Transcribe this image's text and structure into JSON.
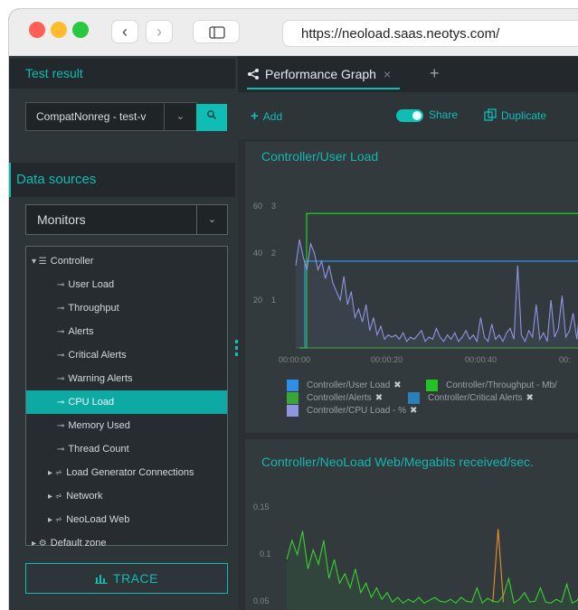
{
  "browser": {
    "url": "https://neoload.saas.neotys.com/",
    "back_glyph": "‹",
    "forward_glyph": "›"
  },
  "sidebar": {
    "test_result_title": "Test result",
    "test_select_value": "CompatNonreg - test-v",
    "data_sources_title": "Data sources",
    "monitors_select_value": "Monitors",
    "tree": [
      {
        "label": "Controller",
        "level": 0,
        "kind": "group-open",
        "glyph": "▾ ☰"
      },
      {
        "label": "User Load",
        "level": 1,
        "kind": "counter",
        "glyph": "⊸"
      },
      {
        "label": "Throughput",
        "level": 1,
        "kind": "counter",
        "glyph": "⊸"
      },
      {
        "label": "Alerts",
        "level": 1,
        "kind": "counter",
        "glyph": "⊸"
      },
      {
        "label": "Critical Alerts",
        "level": 1,
        "kind": "counter",
        "glyph": "⊸"
      },
      {
        "label": "Warning Alerts",
        "level": 1,
        "kind": "counter",
        "glyph": "⊸"
      },
      {
        "label": "CPU Load",
        "level": 1,
        "kind": "counter",
        "selected": true,
        "glyph": "⊸"
      },
      {
        "label": "Memory Used",
        "level": 1,
        "kind": "counter",
        "glyph": "⊸"
      },
      {
        "label": "Thread Count",
        "level": 1,
        "kind": "counter",
        "glyph": "⊸"
      },
      {
        "label": "Load Generator Connections",
        "level": 1,
        "kind": "group-closed",
        "glyph": "▸ ⩫"
      },
      {
        "label": "Network",
        "level": 1,
        "kind": "group-closed",
        "glyph": "▸ ⩫"
      },
      {
        "label": "NeoLoad Web",
        "level": 1,
        "kind": "group-closed",
        "glyph": "▸ ⩫"
      },
      {
        "label": "Default zone",
        "level": 0,
        "kind": "group-closed",
        "glyph": "▸ ⚙"
      }
    ],
    "trace_label": "TRACE"
  },
  "main": {
    "tab_label": "Performance Graph",
    "tab_close": "×",
    "tab_add": "+",
    "toolbar": {
      "add_label": "Add",
      "share_label": "Share",
      "duplicate_label": "Duplicate"
    }
  },
  "chart_data": [
    {
      "type": "line",
      "title": "Controller/User Load",
      "left_axis_ticks": [
        "60",
        "40",
        "20"
      ],
      "right_axis_ticks": [
        "3",
        "2",
        "1"
      ],
      "x_ticks": [
        "00:00:00",
        "00:00:20",
        "00:00:40",
        "00:"
      ],
      "series": [
        {
          "name": "Controller/User Load",
          "color": "#2f8fe8",
          "values": [
            2.0,
            2.0,
            2.0
          ]
        },
        {
          "name": "Controller/Throughput - Mb/",
          "color": "#22c522",
          "values": [
            0,
            62,
            62
          ]
        },
        {
          "name": "Controller/Alerts",
          "color": "#3aa63a",
          "values": [
            0,
            0,
            0
          ]
        },
        {
          "name": "Controller/Critical Alerts",
          "color": "#2a7fb8",
          "values": [
            0,
            0,
            0
          ]
        },
        {
          "name": "Controller/CPU Load - %",
          "color": "#8f95e0",
          "values": [
            38,
            50,
            42,
            36,
            48,
            44,
            36,
            40,
            32,
            38,
            30,
            26,
            22,
            33,
            20,
            26,
            14,
            18,
            12,
            20,
            8,
            14,
            6,
            10,
            4,
            6,
            5,
            6,
            4,
            7,
            3,
            5,
            4,
            6,
            8,
            3,
            5,
            4,
            9,
            5,
            3,
            6,
            4,
            7,
            3,
            5,
            8,
            4,
            6,
            3,
            14,
            5,
            3,
            11,
            4,
            6,
            3,
            7,
            9,
            4,
            38,
            6,
            3,
            8,
            5,
            20,
            4,
            7,
            3,
            22,
            5,
            9,
            24,
            5,
            8,
            16,
            4,
            21,
            6,
            5
          ]
        }
      ],
      "legend": [
        {
          "label": "Controller/User Load",
          "color": "#2f8fe8"
        },
        {
          "label": "Controller/Throughput - Mb/",
          "color": "#22c522"
        },
        {
          "label": "Controller/Alerts",
          "color": "#3aa63a"
        },
        {
          "label": "Controller/Critical Alerts",
          "color": "#2a7fb8"
        },
        {
          "label": "Controller/CPU Load - %",
          "color": "#8f95e0"
        }
      ],
      "legend_remove_glyph": "✖"
    },
    {
      "type": "line",
      "title": "Controller/NeoLoad Web/Megabits received/sec.",
      "y_ticks": [
        "0.15",
        "0.1",
        "0.05"
      ],
      "series": [
        {
          "name": "",
          "color": "#38d12e",
          "values": [
            0.09,
            0.11,
            0.095,
            0.12,
            0.08,
            0.1,
            0.085,
            0.11,
            0.07,
            0.09,
            0.065,
            0.075,
            0.06,
            0.08,
            0.055,
            0.065,
            0.05,
            0.06,
            0.048,
            0.055,
            0.045,
            0.05,
            0.044,
            0.048,
            0.045,
            0.05,
            0.044,
            0.047,
            0.05,
            0.046,
            0.045,
            0.048,
            0.044,
            0.05,
            0.046,
            0.045,
            0.06,
            0.044,
            0.049,
            0.046,
            0.045,
            0.052,
            0.07,
            0.044,
            0.048,
            0.055,
            0.045,
            0.046,
            0.06,
            0.045,
            0.044,
            0.048,
            0.045,
            0.064,
            0.044,
            0.047,
            0.06,
            0.045
          ]
        },
        {
          "name": "",
          "color": "#e8902a",
          "values": [
            null,
            null,
            null,
            null,
            null,
            null,
            null,
            null,
            null,
            null,
            null,
            null,
            null,
            null,
            null,
            null,
            null,
            null,
            null,
            null,
            null,
            null,
            null,
            null,
            null,
            null,
            null,
            null,
            null,
            null,
            null,
            null,
            null,
            null,
            null,
            null,
            null,
            null,
            null,
            0.045,
            0.122,
            0.045,
            null,
            null,
            null,
            null,
            null,
            null,
            null,
            null,
            null,
            null,
            null,
            null,
            null,
            null,
            null,
            null
          ]
        }
      ]
    }
  ]
}
